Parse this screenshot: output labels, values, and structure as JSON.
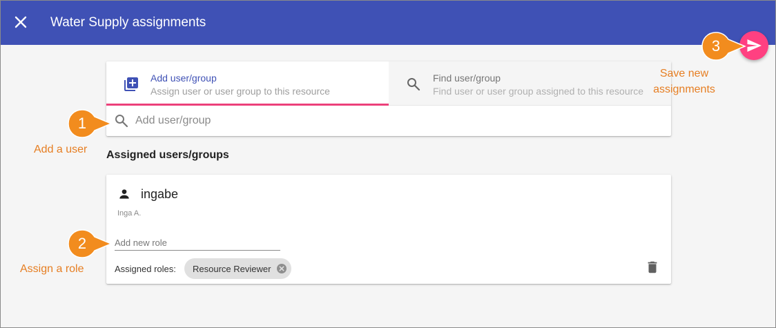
{
  "header": {
    "title": "Water Supply assignments",
    "close_icon": "close-icon",
    "bg_color": "#3f51b5"
  },
  "tabs": [
    {
      "label": "Add user/group",
      "description": "Assign user or user group to this resource",
      "icon": "add-box-icon",
      "active": true
    },
    {
      "label": "Find user/group",
      "description": "Find user or user group assigned to this resource",
      "icon": "search-icon",
      "active": false
    }
  ],
  "search": {
    "placeholder": "Add user/group",
    "value": ""
  },
  "assigned": {
    "title": "Assigned users/groups",
    "users": [
      {
        "username": "ingabe",
        "full_name": "Inga A.",
        "role_placeholder": "Add new role",
        "roles_label": "Assigned roles:",
        "roles": [
          "Resource Reviewer"
        ]
      }
    ]
  },
  "fab": {
    "icon": "send-icon",
    "color": "#ff4081"
  },
  "callouts": [
    {
      "number": "1",
      "label": "Add a user"
    },
    {
      "number": "2",
      "label": "Assign a role"
    },
    {
      "number": "3",
      "label": "Save new assignments"
    }
  ],
  "colors": {
    "accent": "#ec407a",
    "callout": "#f28c1e",
    "annotation_text": "#e67e22"
  }
}
